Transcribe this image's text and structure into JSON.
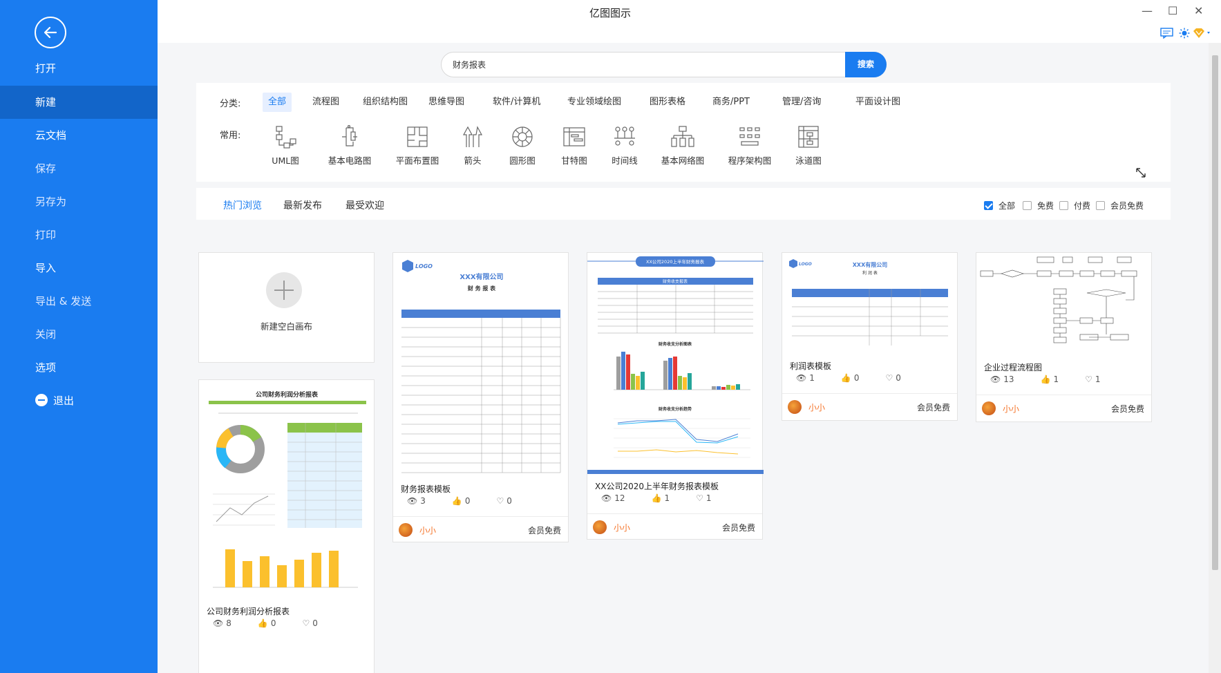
{
  "app": {
    "title": "亿图图示",
    "window_controls": [
      "—",
      "☐",
      "✕"
    ]
  },
  "sidebar": {
    "items": [
      {
        "label": "打开"
      },
      {
        "label": "新建"
      },
      {
        "label": "云文档"
      },
      {
        "label": "保存"
      },
      {
        "label": "另存为"
      },
      {
        "label": "打印"
      },
      {
        "label": "导入"
      },
      {
        "label": "导出 & 发送"
      },
      {
        "label": "关闭"
      },
      {
        "label": "选项"
      },
      {
        "label": "退出"
      }
    ],
    "active_index": 1
  },
  "search": {
    "value": "财务报表",
    "button_label": "搜索"
  },
  "filters": {
    "category_label": "分类:",
    "categories": [
      "全部",
      "流程图",
      "组织结构图",
      "思维导图",
      "软件/计算机",
      "专业领域绘图",
      "图形表格",
      "商务/PPT",
      "管理/咨询",
      "平面设计图"
    ],
    "active_category": 0,
    "common_label": "常用:",
    "common": [
      {
        "label": "UML图",
        "icon": "uml-icon"
      },
      {
        "label": "基本电路图",
        "icon": "circuit-icon"
      },
      {
        "label": "平面布置图",
        "icon": "floorplan-icon"
      },
      {
        "label": "箭头",
        "icon": "arrow-icon"
      },
      {
        "label": "圆形图",
        "icon": "circle-diagram-icon"
      },
      {
        "label": "甘特图",
        "icon": "gantt-icon"
      },
      {
        "label": "时间线",
        "icon": "timeline-icon"
      },
      {
        "label": "基本网络图",
        "icon": "network-icon"
      },
      {
        "label": "程序架构图",
        "icon": "architecture-icon"
      },
      {
        "label": "泳道图",
        "icon": "swimlane-icon"
      }
    ]
  },
  "tabs": {
    "items": [
      "热门浏览",
      "最新发布",
      "最受欢迎"
    ],
    "active": 0,
    "checkboxes": [
      {
        "label": "全部",
        "checked": true
      },
      {
        "label": "免费",
        "checked": false
      },
      {
        "label": "付费",
        "checked": false
      },
      {
        "label": "会员免费",
        "checked": false
      }
    ]
  },
  "new_canvas": {
    "label": "新建空白画布"
  },
  "templates": [
    {
      "title": "财务报表模板",
      "views": "3",
      "likes": "0",
      "favs": "0",
      "author": "小小",
      "license": "会员免费",
      "thumb_text": {
        "logo": "LOGO",
        "company": "XXX有限公司",
        "doc": "财 务 报 表"
      }
    },
    {
      "title": "XX公司2020上半年财务报表模板",
      "views": "12",
      "likes": "1",
      "favs": "1",
      "author": "小小",
      "license": "会员免费",
      "thumb_text": {
        "banner": "XX公司2020上半年财务报表",
        "t1": "财务收支报表",
        "t2": "财务收支分析图表",
        "t3": "财务收支分析趋势"
      }
    },
    {
      "title": "利润表模板",
      "views": "1",
      "likes": "0",
      "favs": "0",
      "author": "小小",
      "license": "会员免费",
      "thumb_text": {
        "logo": "LOGO",
        "company": "XXX有限公司",
        "doc": "利 润 表"
      }
    },
    {
      "title": "企业过程流程图",
      "views": "13",
      "likes": "1",
      "favs": "1",
      "author": "小小",
      "license": "会员免费"
    },
    {
      "title": "公司财务利润分析报表",
      "views": "8",
      "likes": "0",
      "favs": "0",
      "thumb_text": {
        "header": "公司财务利润分析报表"
      }
    }
  ],
  "colors": {
    "accent": "#1a7cf0",
    "sidebar": "#1a7cf0",
    "sidebar_active": "#1265c9",
    "author": "#f5742a"
  }
}
